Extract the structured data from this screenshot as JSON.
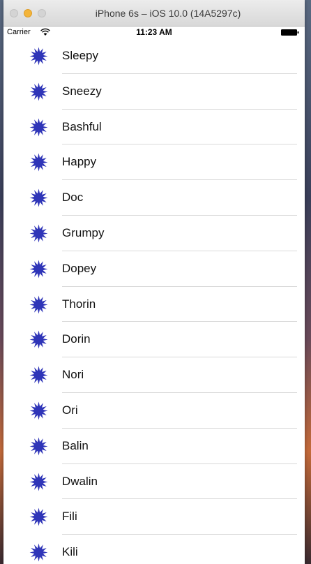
{
  "window": {
    "title": "iPhone 6s – iOS 10.0 (14A5297c)"
  },
  "status_bar": {
    "carrier": "Carrier",
    "time": "11:23 AM",
    "wifi_icon": "wifi-icon",
    "battery_icon": "battery-icon"
  },
  "list": {
    "row_icon": "star-icon",
    "icon_color": "#2f35b8",
    "items": [
      {
        "label": "Sleepy"
      },
      {
        "label": "Sneezy"
      },
      {
        "label": "Bashful"
      },
      {
        "label": "Happy"
      },
      {
        "label": "Doc"
      },
      {
        "label": "Grumpy"
      },
      {
        "label": "Dopey"
      },
      {
        "label": "Thorin"
      },
      {
        "label": "Dorin"
      },
      {
        "label": "Nori"
      },
      {
        "label": "Ori"
      },
      {
        "label": "Balin"
      },
      {
        "label": "Dwalin"
      },
      {
        "label": "Fili"
      },
      {
        "label": "Kili"
      }
    ]
  }
}
